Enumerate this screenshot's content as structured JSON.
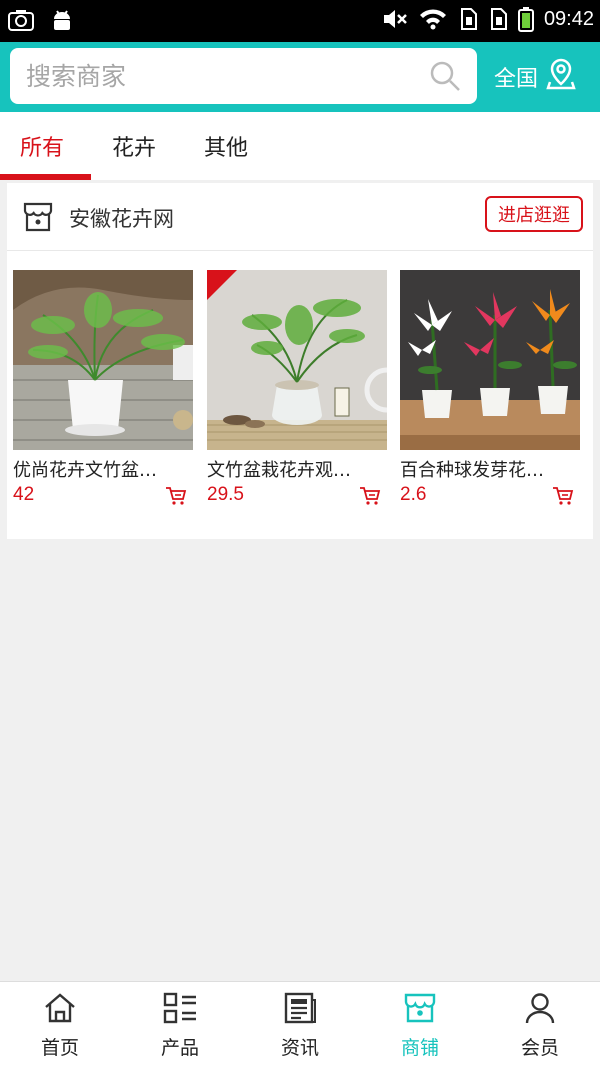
{
  "status_bar": {
    "time": "09:42",
    "icons": [
      "screenshot-icon",
      "android-icon",
      "mute-icon",
      "wifi-icon",
      "sim-icon",
      "sim2-icon",
      "battery-icon"
    ]
  },
  "search": {
    "placeholder": "搜索商家",
    "icon": "search-icon"
  },
  "region": {
    "label": "全国",
    "icon": "location-pin-icon"
  },
  "tabs": [
    {
      "label": "所有",
      "active": true
    },
    {
      "label": "花卉",
      "active": false
    },
    {
      "label": "其他",
      "active": false
    }
  ],
  "shop": {
    "name": "安徽花卉网",
    "icon": "store-icon",
    "visit_label": "进店逛逛",
    "products": [
      {
        "name": "优尚花卉文竹盆…",
        "price": "42"
      },
      {
        "name": "文竹盆栽花卉观…",
        "price": "29.5"
      },
      {
        "name": "百合种球发芽花…",
        "price": "2.6"
      }
    ]
  },
  "bottom_nav": [
    {
      "label": "首页",
      "icon": "home-icon",
      "active": false
    },
    {
      "label": "产品",
      "icon": "grid-list-icon",
      "active": false
    },
    {
      "label": "资讯",
      "icon": "news-icon",
      "active": false
    },
    {
      "label": "商铺",
      "icon": "store-icon",
      "active": true
    },
    {
      "label": "会员",
      "icon": "user-icon",
      "active": false
    }
  ],
  "colors": {
    "brand": "#17c3bd",
    "accent_red": "#d8121a"
  }
}
